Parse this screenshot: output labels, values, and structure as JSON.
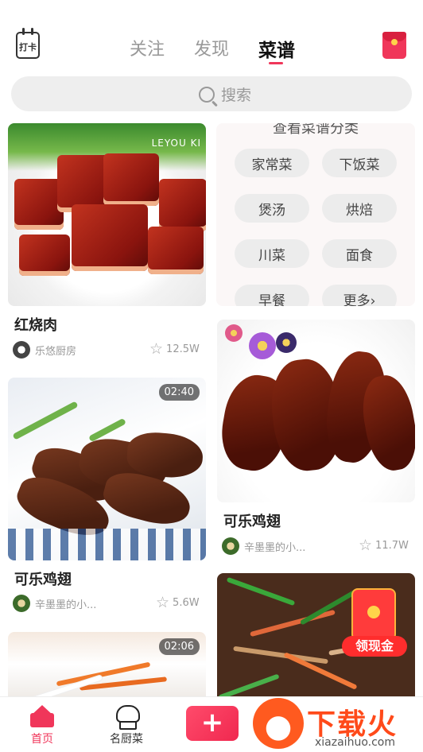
{
  "header": {
    "checkin_label": "打卡",
    "tabs": [
      "关注",
      "发现",
      "菜谱"
    ],
    "active_tab": "菜谱"
  },
  "search": {
    "placeholder": "搜索"
  },
  "category_card": {
    "title": "查看菜谱分类",
    "items": [
      "家常菜",
      "下饭菜",
      "煲汤",
      "烘焙",
      "川菜",
      "面食",
      "早餐",
      "更多›"
    ]
  },
  "feed": [
    {
      "title": "红烧肉",
      "author": "乐悠厨房",
      "likes": "12.5W",
      "watermark": "LEYOU KI"
    },
    {
      "title": "可乐鸡翅",
      "author": "辛墨墨的小...",
      "likes": "11.7W"
    },
    {
      "title": "可乐鸡翅",
      "author": "辛墨墨的小...",
      "likes": "5.6W",
      "duration": "02:40"
    },
    {
      "duration": "02:06"
    }
  ],
  "promo": {
    "label": "领现金"
  },
  "bottom_nav": {
    "home": "首页",
    "chefs": "名厨菜",
    "add": "+"
  },
  "watermark": {
    "brand": "下载火",
    "url": "xiazaihuo.com"
  },
  "colors": {
    "accent": "#f0365a",
    "muted": "#999999"
  }
}
